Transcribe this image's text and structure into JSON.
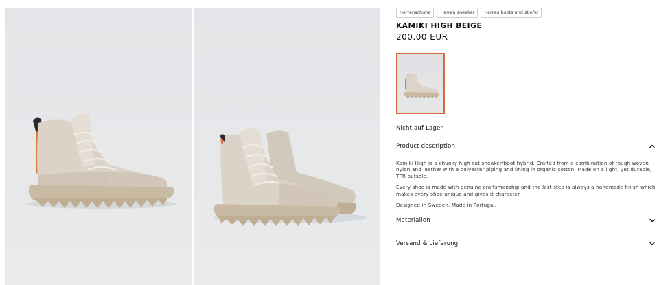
{
  "breadcrumb_tags": [
    "Herrenschuhe",
    "Herren sneaker",
    "Herren boots und stiefel"
  ],
  "product": {
    "title": "KAMIKI HIGH BEIGE",
    "price": "200.00 EUR",
    "availability": "Nicht auf Lager"
  },
  "accordion": {
    "description": {
      "label": "Product description",
      "paragraphs": [
        "Kamiki High is a chunky high cut sneaker/boot hybrid. Crafted from a combination of rough woven nylon and leather with a polyester piping and lining in organic cotton. Made on a light, yet durable, TPR outsole.",
        "Every shoe is made with genuine craftsmanship and the last step is always a handmade finish which makes every shoe unique and gives it character.",
        "Designed in Sweden. Made in Portugal."
      ],
      "icon": "chevron-up-icon"
    },
    "materials": {
      "label": "Materialien",
      "icon": "chevron-down-icon"
    },
    "shipping": {
      "label": "Versand & Lieferung",
      "icon": "chevron-down-icon"
    }
  },
  "colors": {
    "thumbnail_border": "#d9683a",
    "shoe_upper": "#d8cfc4",
    "shoe_sole": "#c4b59c",
    "heel_tab": "#e07a3c"
  }
}
